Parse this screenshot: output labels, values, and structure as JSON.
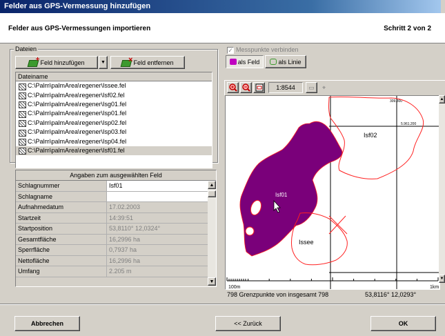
{
  "window": {
    "title": "Felder aus GPS-Vermessung hinzufügen"
  },
  "header": {
    "title": "Felder aus GPS-Vermessungen importieren",
    "step": "Schritt 2 von 2"
  },
  "files": {
    "group_label": "Dateien",
    "add_button": "Feld hinzufügen",
    "remove_button": "Feld entfernen",
    "column_header": "Dateiname",
    "items": [
      "C:\\Palm\\palmArea\\regener\\Issee.fel",
      "C:\\Palm\\palmArea\\regener\\Isf02.fel",
      "C:\\Palm\\palmArea\\regener\\Isg01.fel",
      "C:\\Palm\\palmArea\\regener\\Isp01.fel",
      "C:\\Palm\\palmArea\\regener\\Isp02.fel",
      "C:\\Palm\\palmArea\\regener\\Isp03.fel",
      "C:\\Palm\\palmArea\\regener\\Isp04.fel",
      "C:\\Palm\\palmArea\\regener\\Isf01.fel"
    ],
    "selected_index": 7
  },
  "details": {
    "header": "Angaben zum ausgewählten Feld",
    "rows": [
      {
        "label": "Schlagnummer",
        "value": "Isf01"
      },
      {
        "label": "Schlagname",
        "value": ""
      },
      {
        "label": "Aufnahmedatum",
        "value": "17.02.2003"
      },
      {
        "label": "Startzeit",
        "value": "14:39:51"
      },
      {
        "label": "Startposition",
        "value": "53,8110° 12,0324°"
      },
      {
        "label": "Gesamtfläche",
        "value": "16,2996 ha"
      },
      {
        "label": "Sperrfläche",
        "value": "0,7937 ha"
      },
      {
        "label": "Nettofläche",
        "value": "16,2996 ha"
      },
      {
        "label": "Umfang",
        "value": "2.205 m"
      }
    ]
  },
  "map_panel": {
    "connect_points_label": "Messpunkte verbinden",
    "as_field_button": "als Feld",
    "as_line_button": "als Linie",
    "scale": "1:8544",
    "grid_label_top": "309.300",
    "grid_label_right": "5.961.200",
    "field_labels": [
      "Isf02",
      "Isf01",
      "Issee"
    ],
    "scalebar_labels": [
      "100m",
      "1km"
    ],
    "status_points": "798 Grenzpunkte von insgesamt 798",
    "status_coords": "53,8116° 12,0293°"
  },
  "colors": {
    "field_fill": "#7a007a",
    "outline": "#ff2020",
    "grid": "#000000"
  },
  "footer": {
    "cancel_button": "Abbrechen",
    "back_button": "<< Zurück",
    "ok_button": "OK"
  }
}
